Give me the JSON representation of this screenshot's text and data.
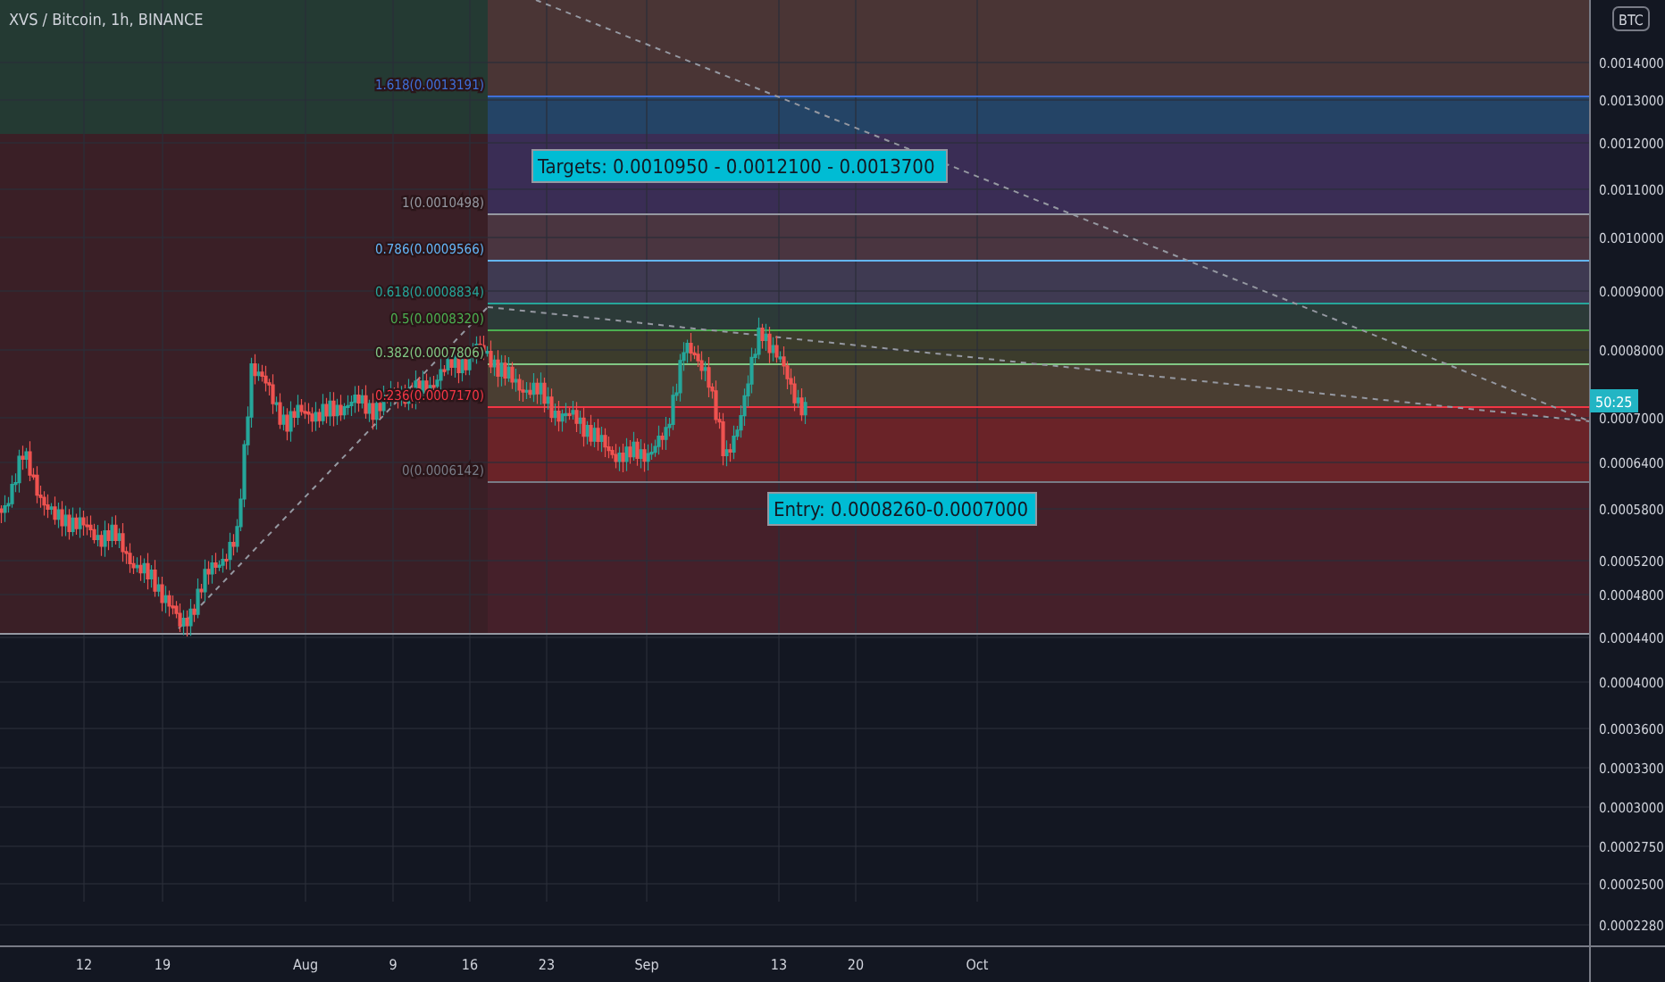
{
  "header": {
    "symbol": "XVS / Bitcoin, 1h, BINANCE"
  },
  "fib_levels": [
    {
      "label": "1.618(0.0013191)",
      "color": "#3f6fd8"
    },
    {
      "label": "1(0.0010498)",
      "color": "#9598a1"
    },
    {
      "label": "0.786(0.0009566)",
      "color": "#64b5f6"
    },
    {
      "label": "0.618(0.0008834)",
      "color": "#26a69a"
    },
    {
      "label": "0.5(0.0008320)",
      "color": "#4caf50"
    },
    {
      "label": "0.382(0.0007806)",
      "color": "#81c784"
    },
    {
      "label": "0.236(0.0007170)",
      "color": "#f23645"
    },
    {
      "label": "0(0.0006142)",
      "color": "#787b86"
    }
  ],
  "annotations": [
    {
      "kind": "targets",
      "text": "Targets: 0.0010950 - 0.0012100 - 0.0013700"
    },
    {
      "kind": "entry",
      "text": "Entry: 0.0008260-0.0007000"
    }
  ],
  "price_axis": {
    "badge": "BTC",
    "countdown": "50:25",
    "ticks": [
      "0.0014000",
      "0.0013000",
      "0.0012000",
      "0.0011000",
      "0.0010000",
      "0.0009000",
      "0.0008000",
      "0.0007000",
      "0.0006400",
      "0.0005800",
      "0.0005200",
      "0.0004800",
      "0.0004400",
      "0.0004000",
      "0.0003600",
      "0.0003300",
      "0.0003000",
      "0.0002750",
      "0.0002500",
      "0.0002280"
    ]
  },
  "time_axis": {
    "ticks": [
      "12",
      "19",
      "Aug",
      "9",
      "16",
      "23",
      "Sep",
      "13",
      "20",
      "Oct"
    ]
  }
}
